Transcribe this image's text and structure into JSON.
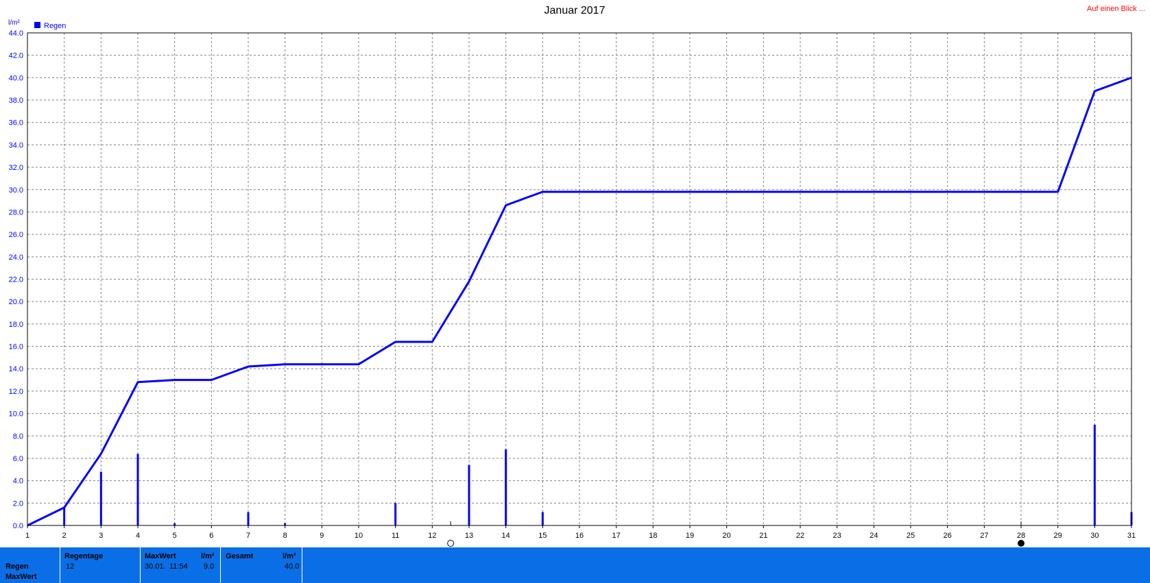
{
  "link": "Auf einen Blick ...",
  "colors": {
    "series": "#0000ff",
    "link": "#ff0000",
    "footer_bg": "#0a6fe6",
    "grid": "#808080"
  },
  "chart_data": {
    "type": "bar+line",
    "title": "Januar 2017",
    "ylabel": "l/m²",
    "legend": [
      "Regen"
    ],
    "legend_position": "top-left",
    "grid": true,
    "ylim": [
      0,
      44
    ],
    "y_ticks": [
      "0.0",
      "2.0",
      "4.0",
      "6.0",
      "8.0",
      "10.0",
      "12.0",
      "14.0",
      "16.0",
      "18.0",
      "20.0",
      "22.0",
      "24.0",
      "26.0",
      "28.0",
      "30.0",
      "32.0",
      "34.0",
      "36.0",
      "38.0",
      "40.0",
      "42.0",
      "44.0"
    ],
    "x_ticks": [
      "1",
      "2",
      "3",
      "4",
      "5",
      "6",
      "7",
      "8",
      "9",
      "10",
      "11",
      "12",
      "13",
      "14",
      "15",
      "16",
      "17",
      "18",
      "19",
      "20",
      "21",
      "22",
      "23",
      "24",
      "25",
      "26",
      "27",
      "28",
      "29",
      "30",
      "31"
    ],
    "xlim": [
      1,
      31
    ],
    "moon_markers": [
      {
        "day": 12.5,
        "phase": "full-moon-icon"
      },
      {
        "day": 28,
        "phase": "new-moon-icon"
      }
    ],
    "series": [
      {
        "name": "Regen",
        "kind": "bars",
        "x": [
          2,
          3,
          4,
          5,
          7,
          8,
          11,
          13,
          14,
          15,
          30,
          31
        ],
        "values": [
          1.6,
          4.8,
          6.4,
          0.2,
          1.2,
          0.2,
          2.0,
          5.4,
          6.8,
          1.2,
          9.0,
          1.2
        ]
      },
      {
        "kind": "cumulative-line",
        "x": [
          1,
          2,
          3,
          4,
          5,
          6,
          7,
          8,
          9,
          10,
          11,
          12,
          13,
          14,
          15,
          16,
          17,
          18,
          19,
          20,
          21,
          22,
          23,
          24,
          25,
          26,
          27,
          28,
          29,
          30,
          31
        ],
        "values": [
          0,
          1.6,
          6.4,
          12.8,
          13.0,
          13.0,
          14.2,
          14.4,
          14.4,
          14.4,
          16.4,
          16.4,
          21.8,
          28.6,
          29.8,
          29.8,
          29.8,
          29.8,
          29.8,
          29.8,
          29.8,
          29.8,
          29.8,
          29.8,
          29.8,
          29.8,
          29.8,
          29.8,
          29.8,
          38.8,
          40.0
        ]
      }
    ]
  },
  "footer": {
    "row_labels": [
      "Regen",
      "MaxWert"
    ],
    "regentage_label": "Regentage",
    "regentage_value": "12",
    "maxwert_label": "MaxWert",
    "maxwert_unit": "l/m²",
    "maxwert_date": "30.01.",
    "maxwert_time": "11:54",
    "maxwert_value": "9.0",
    "gesamt_label": "Gesamt",
    "gesamt_unit": "l/m²",
    "gesamt_value": "40.0"
  }
}
